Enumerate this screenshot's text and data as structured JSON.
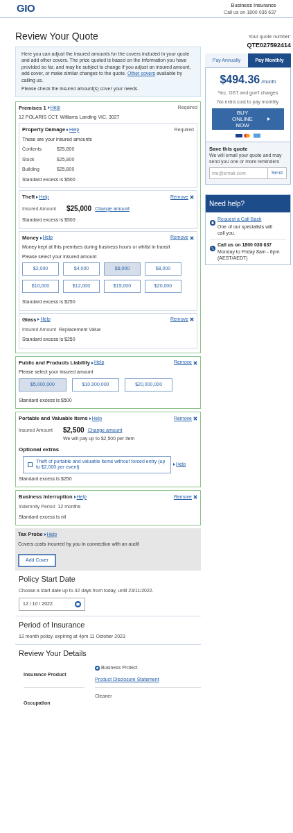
{
  "header": {
    "logo": "GIO",
    "title": "Business Insurance",
    "phone": "Call us on 1800 036 637"
  },
  "heading": "Review Your Quote",
  "intro": {
    "before": "Here you can adjust the insured amounts for the covers included in your quote and add other covers. The price quoted is based on the information you have provided so far, and may be subject to change if you adjust an insured amount, add cover, or make similar changes to the quote.",
    "link": "Other covers",
    "after": "available by calling us.",
    "note": "Please check the insured amount(s) cover your needs."
  },
  "covers": [
    {
      "title": "Premises 1",
      "help": "Help",
      "added": true,
      "badge": "Required",
      "lines": [
        {
          "kind": "text",
          "text": "12 POLARIS CCT, Williams Landing VIC, 3027"
        }
      ],
      "children": [
        {
          "title": "Property Damage",
          "help": "Help",
          "badge": "Required",
          "lines": [
            {
              "kind": "text",
              "text": "These are your insured amounts"
            },
            {
              "kind": "rows",
              "rows": [
                {
                  "label": "Contents",
                  "value": "$25,800"
                },
                {
                  "label": "Stock",
                  "value": "$25,800"
                },
                {
                  "label": "Building",
                  "value": "$25,800"
                }
              ]
            },
            {
              "kind": "text",
              "text": "Standard excess is $500"
            }
          ]
        },
        {
          "title": "Theft",
          "help": "Help",
          "remove": "Remove",
          "lines": [
            {
              "kind": "amount",
              "label": "Insured Amount",
              "value": "$25,000",
              "link": "Change amount"
            },
            {
              "kind": "text",
              "text": "Standard excess is $500"
            }
          ]
        },
        {
          "title": "Money",
          "help": "Help",
          "remove": "Remove",
          "lines": [
            {
              "kind": "text",
              "text": "Money kept at this premises during business hours or whilst in transit"
            },
            {
              "kind": "text",
              "text": "Please select your insured amount"
            },
            {
              "kind": "options",
              "options": [
                {
                  "label": "$2,000",
                  "selected": false
                },
                {
                  "label": "$4,000",
                  "selected": false
                },
                {
                  "label": "$6,000",
                  "selected": true
                },
                {
                  "label": "$8,000",
                  "selected": false
                },
                {
                  "label": "$10,000",
                  "selected": false
                },
                {
                  "label": "$12,000",
                  "selected": false
                },
                {
                  "label": "$15,000",
                  "selected": false
                },
                {
                  "label": "$20,000",
                  "selected": false
                }
              ]
            },
            {
              "kind": "text",
              "text": "Standard excess is $250"
            }
          ]
        },
        {
          "title": "Glass",
          "help": "Help",
          "remove": "Remove",
          "lines": [
            {
              "kind": "value",
              "label": "Insured Amount",
              "value": "Replacement Value"
            },
            {
              "kind": "text",
              "text": "Standard excess is $250"
            }
          ]
        }
      ]
    },
    {
      "title": "Public and Products Liability",
      "help": "Help",
      "added": true,
      "remove": "Remove",
      "lines": [
        {
          "kind": "text",
          "text": "Please select your insured amount"
        },
        {
          "kind": "options",
          "options": [
            {
              "label": "$5,000,000",
              "selected": true
            },
            {
              "label": "$10,000,000",
              "selected": false
            },
            {
              "label": "$20,000,000",
              "selected": false
            }
          ]
        },
        {
          "kind": "text",
          "text": "Standard excess is $500"
        }
      ]
    },
    {
      "title": "Portable and Valuable Items",
      "help": "Help",
      "added": true,
      "remove": "Remove",
      "lines": [
        {
          "kind": "amount",
          "label": "Insured Amount",
          "value": "$2,500",
          "link": "Change amount",
          "note": "We will pay up to $2,500 per item"
        },
        {
          "kind": "subheading",
          "text": "Optional extras"
        },
        {
          "kind": "extra",
          "text": "Theft of portable and valuable items without forced entry (up to $2,000 per event)",
          "checked": false,
          "help": "Help"
        },
        {
          "kind": "text",
          "text": "Standard excess is $250"
        }
      ]
    },
    {
      "title": "Business Interruption",
      "help": "Help",
      "added": true,
      "remove": "Remove",
      "lines": [
        {
          "kind": "value",
          "label": "Indemnity Period",
          "value": "12 months"
        },
        {
          "kind": "text",
          "text": "Standard excess is nil"
        }
      ]
    },
    {
      "title": "Tax Probe",
      "help": "Help",
      "added": false,
      "lines": [
        {
          "kind": "text",
          "text": "Covers costs incurred by you in connection with an audit"
        },
        {
          "kind": "button",
          "text": "Add Cover"
        }
      ]
    }
  ],
  "start_date": {
    "heading": "Policy Start Date",
    "text": "Choose a start date up to 42 days from today, until 23/11/2022.",
    "value": "12 / 10 / 2022"
  },
  "period": {
    "heading": "Period of Insurance",
    "text": "12 month policy, expiring at 4pm 11 October 2023"
  },
  "details": {
    "heading": "Review Your Details",
    "rows": [
      {
        "label": "Insurance Product",
        "value": "Business Protect",
        "link": "Product Disclosure Statement"
      },
      {
        "label": "Occupation",
        "value": "Cleaner"
      }
    ]
  },
  "quote": {
    "label": "Your quote number:",
    "number": "QTE027592414",
    "tabs": [
      {
        "label": "Pay Annually",
        "selected": false
      },
      {
        "label": "Pay Monthly",
        "selected": true
      }
    ],
    "price": "$494.36",
    "unit": "/month",
    "notes": [
      "*inc. GST and gov't charges",
      "No extra cost to pay monthly"
    ],
    "buy": "BUY ONLINE NOW",
    "save_title": "Save this quote",
    "save_text": "We will email your quote and may send you one or more reminders",
    "email_placeholder": "me@email.com",
    "send": "Send"
  },
  "help_box": {
    "title": "Need help?",
    "callback_link": "Request a Call Back",
    "callback_text": "One of our specialists will call you.",
    "call": "Call us on 1800 036 637",
    "hours": "Monday to Friday 8am - 6pm (AEST/AEDT)"
  }
}
